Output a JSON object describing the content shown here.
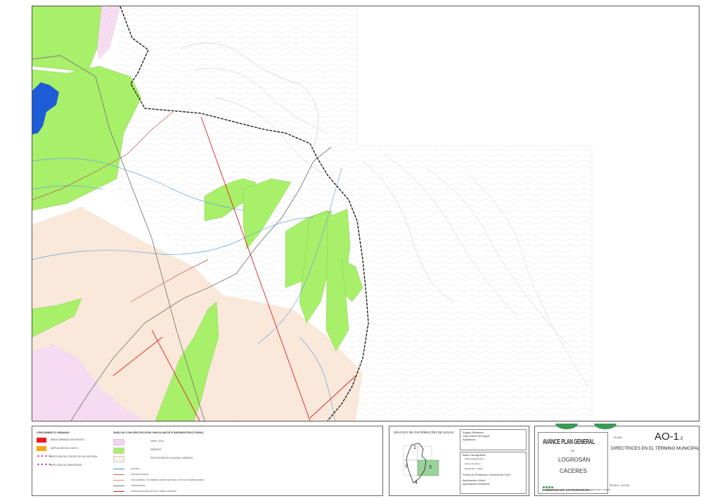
{
  "legend": {
    "group1_title": "CRECIMIENTO URBANO",
    "group1_items": [
      {
        "label": "ÁREAS URBANAS EXISTENTES",
        "color": "#ee1d23"
      },
      {
        "label": "AMPLIACIÓN DEL CASCO",
        "color": "#f7a81b"
      },
      {
        "label": "AFECCIÓN DEL CENTRO DE VÍA PASTORAL",
        "symbol": "▲▲▲▲",
        "color": "#9b3aa0"
      },
      {
        "label": "AFECCIÓN DE CARRETERAS",
        "symbol": "▲▲▲▲",
        "color": "#9b3aa0"
      }
    ],
    "group2_title": "SUELOS CON PROTECCIÓN VINCULANTE E INFRAESTRUCTURAS",
    "group2_items": [
      {
        "label": "ZEPA Y LICS",
        "color": "#f3d3ef"
      },
      {
        "label": "HÁBITATS",
        "color": "#a8ef6a"
      },
      {
        "label": "PROTECCIÓN DE LA FAUNA / HÁBITATS",
        "color": "#fbf0e4"
      }
    ],
    "group2_lines": [
      {
        "label": "CAUCES",
        "color": "#4a90d9"
      },
      {
        "label": "VÍAS PECUARIAS",
        "color": "#c46a48"
      },
      {
        "label": "VÍAS VERDES / VÍA VERDE CAMINO NATURAL (ANTIGUO FERROCARRIL)",
        "color": "#d89a5a"
      },
      {
        "label": "CARRETERAS",
        "color": "#777777"
      },
      {
        "label": "LÍNEAS ELÉCTRICAS ALTA Y MEDIA TENSIÓN",
        "color": "#e02020"
      }
    ]
  },
  "sheets": {
    "title": "GRAFICO DE DISTRIBUCIÓN DE HOJAS",
    "labels": [
      "1",
      "2",
      "3",
      "4"
    ],
    "active": "3"
  },
  "team": {
    "heading": "Equipo Redactor:",
    "name": "José David Gil Duque",
    "role": "Arquitecto",
    "base_heading": "Base Cartográfica:",
    "base_items": [
      "Vuelo fotogramétrico",
      "Apoyo de campo",
      "Restitución y dibujo"
    ],
    "date": "Fecha de Redacción: Noviembre 2012",
    "approval_initial": "Aprobación Inicial:",
    "approval_final": "Aprobación Definitiva:"
  },
  "title_block": {
    "plan_label": "PLANO",
    "plan_code": "AO-1",
    "plan_sub": ".3",
    "plan_title": "DIRECTRICES EN EL TÉRMINO MUNICIPAL",
    "avance": "AVANCE PLAN GENERAL",
    "de": "DE",
    "town": "LOGROSÁN",
    "province": "CÁCERES",
    "consejeria": "CONSEJERÍA DE FOMENTO, VIVIENDA, ORDENACIÓN DEL TERRITORIO Y TURISMO",
    "scale": "ESCALA: 1:20.000",
    "government": "GOBIERNO DE EXTREMADURA"
  }
}
